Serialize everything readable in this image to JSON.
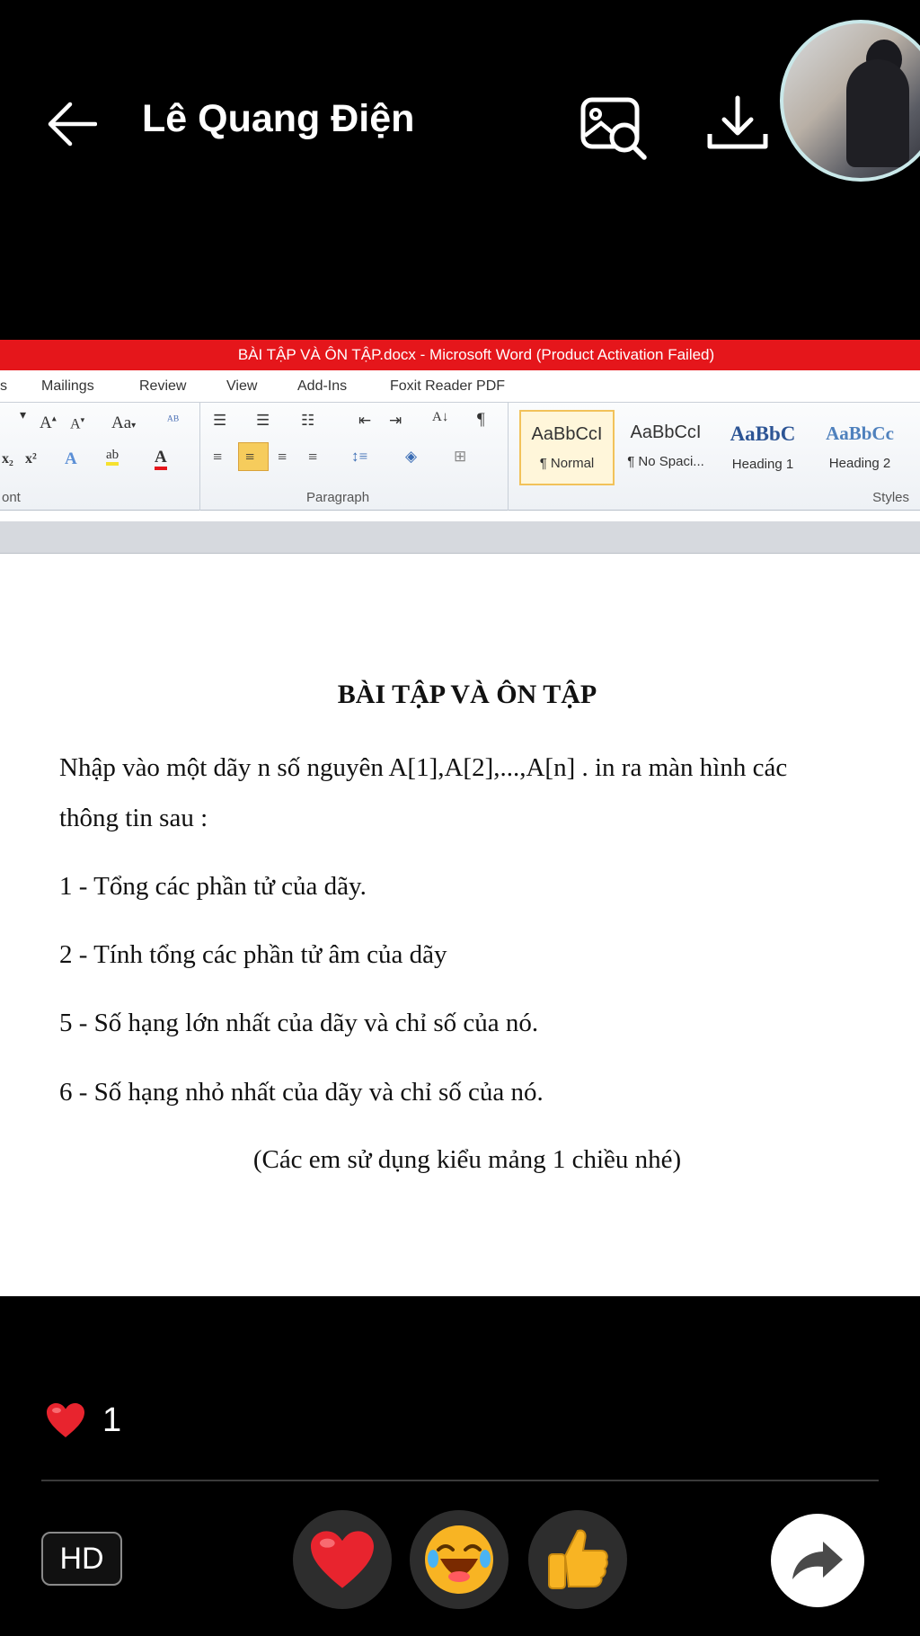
{
  "header": {
    "sender_name": "Lê Quang Điện",
    "icons": [
      "back-arrow-icon",
      "image-search-icon",
      "download-icon"
    ]
  },
  "word": {
    "window_title": "BÀI TẬP VÀ ÔN TẬP.docx - Microsoft Word (Product Activation Failed)",
    "menu_tabs": [
      "s",
      "Mailings",
      "Review",
      "View",
      "Add-Ins",
      "Foxit Reader PDF"
    ],
    "groups": {
      "font": "ont",
      "paragraph": "Paragraph",
      "styles": "Styles"
    },
    "styles": [
      {
        "sample": "AaBbCcI",
        "name": "¶ Normal",
        "selected": true
      },
      {
        "sample": "AaBbCcI",
        "name": "¶ No Spaci...",
        "selected": false
      },
      {
        "sample": "AaBbC",
        "name": "Heading 1",
        "selected": false
      },
      {
        "sample": "AaBbCc",
        "name": "Heading 2",
        "selected": false
      }
    ],
    "accent_color": "#e5161b"
  },
  "document": {
    "title": "BÀI TẬP VÀ ÔN TẬP",
    "intro_line1": "Nhập vào một dãy n số nguyên A[1],A[2],...,A[n] . in ra màn hình các",
    "intro_line2": "thông tin sau :",
    "items": [
      "1 - Tổng các phần tử của dãy.",
      "2 - Tính tổng các phần tử âm của dãy",
      "5 - Số hạng lớn nhất của dãy và chỉ số của nó.",
      "6 - Số hạng nhỏ nhất của dãy và chỉ số của nó."
    ],
    "note": "(Các em sử dụng kiểu mảng 1 chiều nhé)"
  },
  "footer": {
    "reaction_count": "1",
    "hd_label": "HD",
    "reactions": [
      "heart-reaction",
      "laugh-reaction",
      "thumbs-up-reaction"
    ]
  }
}
